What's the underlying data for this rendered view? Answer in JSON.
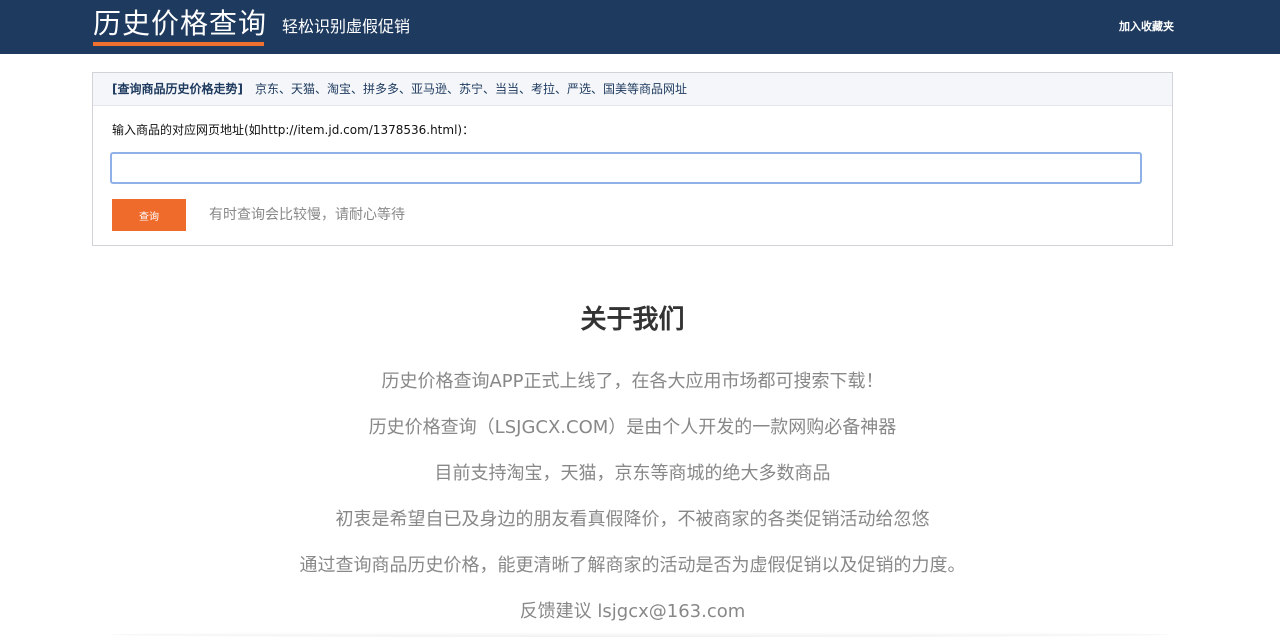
{
  "header": {
    "logo_text": "历史价格查询",
    "slogan": "轻松识别虚假促销",
    "bookmark_label": "加入收藏夹"
  },
  "search": {
    "header_bold": "[查询商品历史价格走势]",
    "header_sites": "京东、天猫、淘宝、拼多多、亚马逊、苏宁、当当、考拉、严选、国美等商品网址",
    "input_label": "输入商品的对应网页地址(如http://item.jd.com/1378536.html)：",
    "input_value": "",
    "input_placeholder": "",
    "button_label": "查询",
    "hint": "有时查询会比较慢，请耐心等待"
  },
  "about": {
    "title": "关于我们",
    "lines": [
      "历史价格查询APP正式上线了，在各大应用市场都可搜索下载！",
      "历史价格查询（LSJGCX.COM）是由个人开发的一款网购必备神器",
      "目前支持淘宝，天猫，京东等商城的绝大多数商品",
      "初衷是希望自已及身边的朋友看真假降价，不被商家的各类促销活动给忽悠",
      "通过查询商品历史价格，能更清晰了解商家的活动是否为虚假促销以及促销的力度。",
      "反馈建议 lsjgcx@163.com"
    ]
  },
  "colors": {
    "header_bg": "#1e3a5f",
    "accent": "#ee6b2c",
    "input_focus_border": "#8fb0e8"
  }
}
